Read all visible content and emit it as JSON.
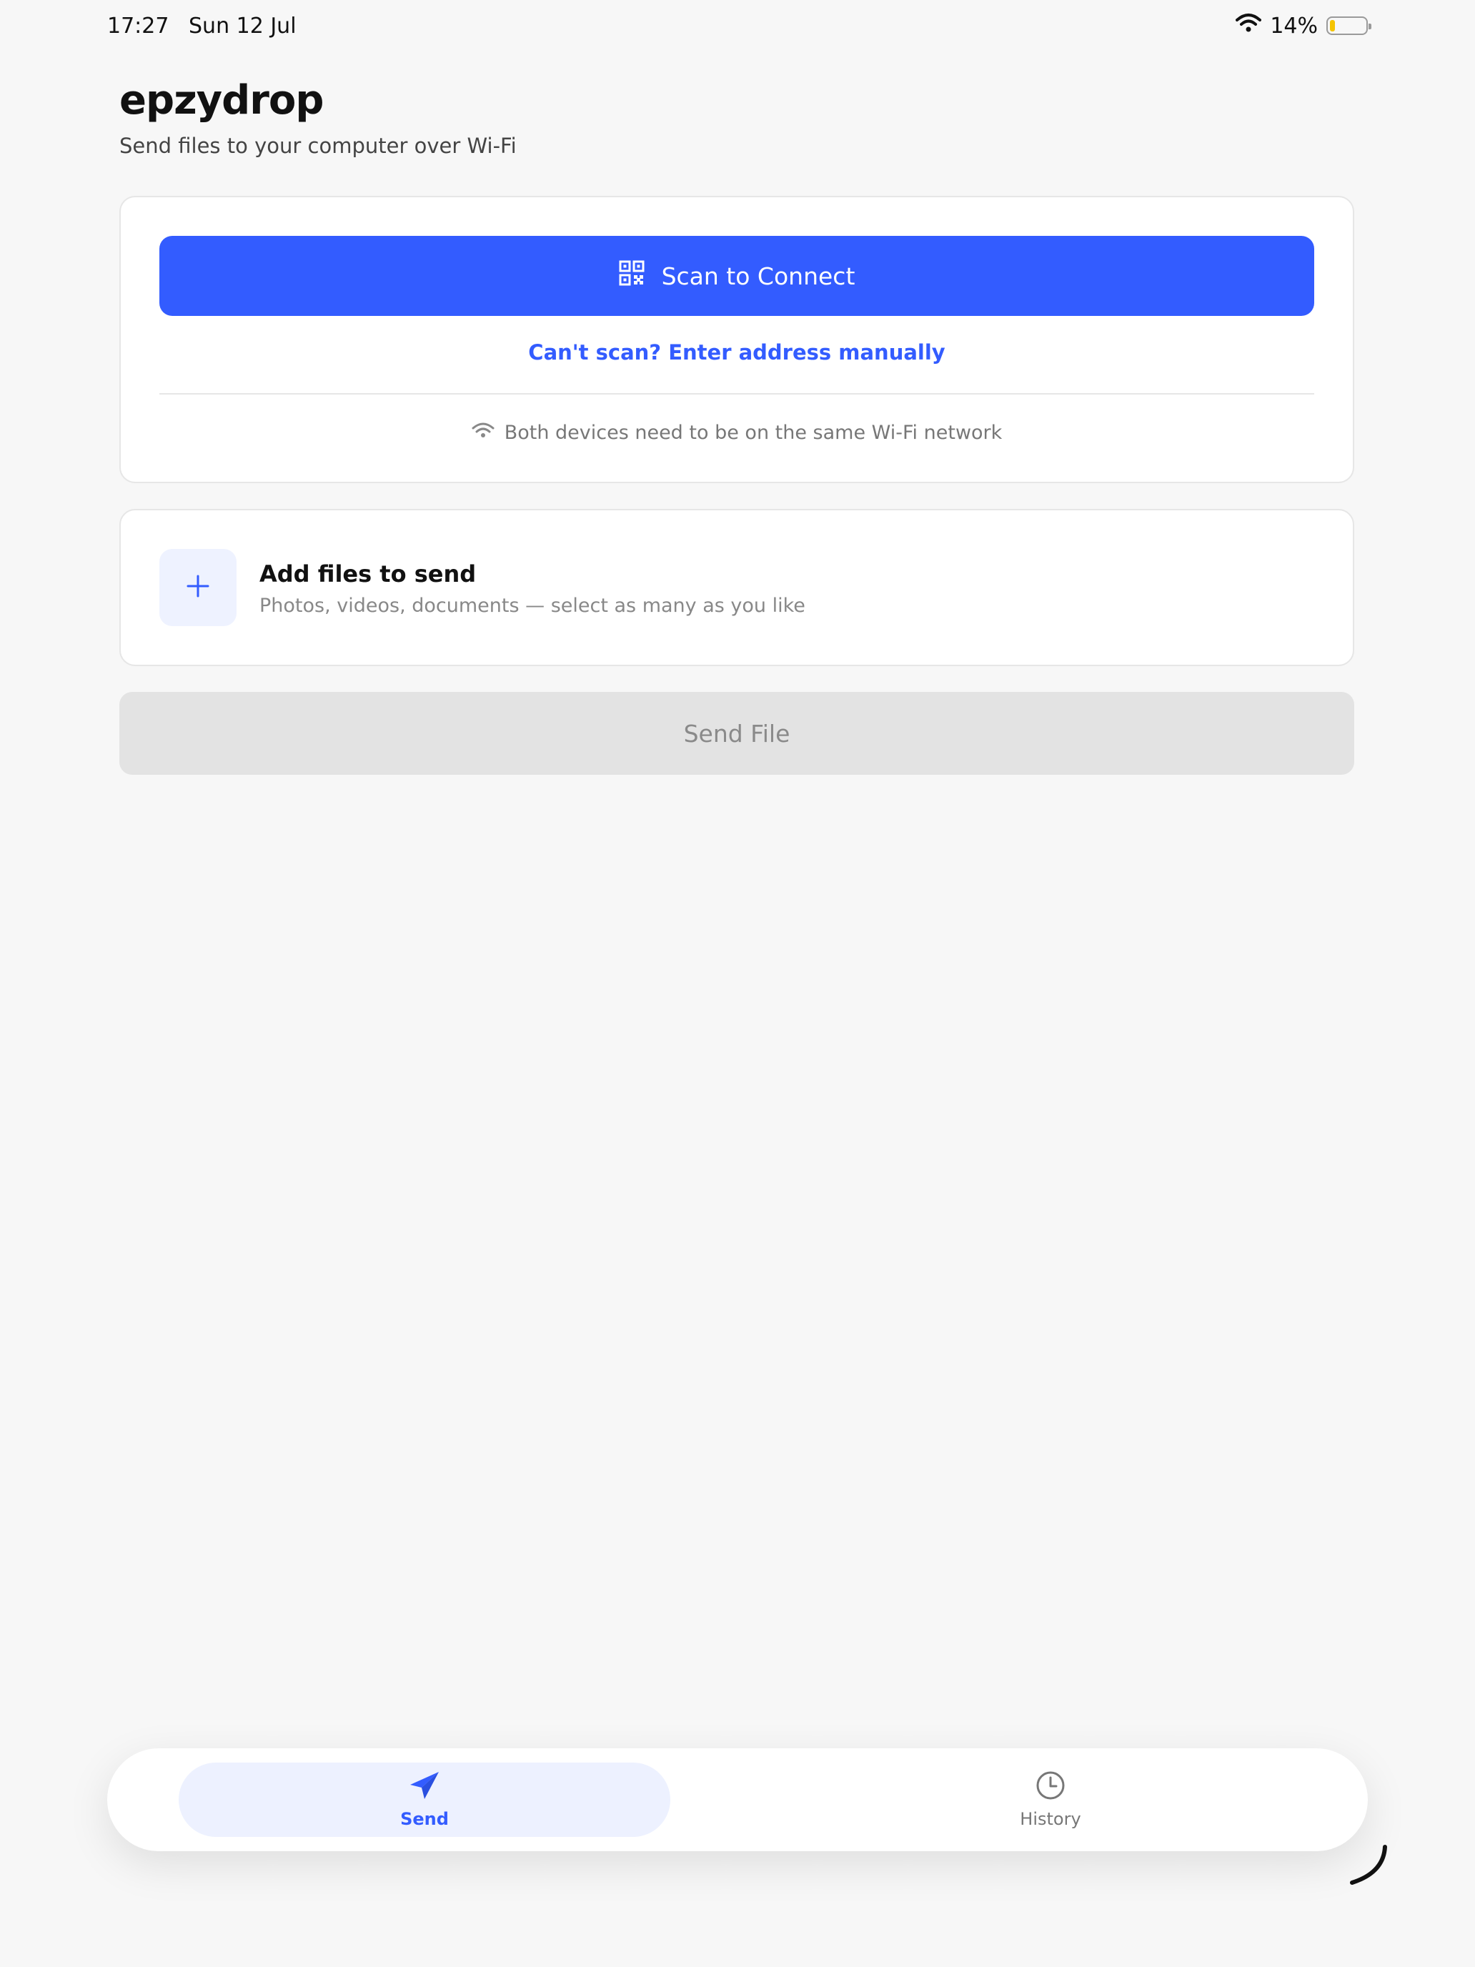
{
  "status_bar": {
    "time": "17:27",
    "date": "Sun 12 Jul",
    "battery_text": "14%",
    "battery_level_percent": 14,
    "icons": [
      "wifi-icon",
      "battery-icon"
    ]
  },
  "header": {
    "title": "epzydrop",
    "subtitle": "Send files to your computer over Wi-Fi"
  },
  "connect_card": {
    "scan_button_label": "Scan to Connect",
    "scan_icon": "qr-code-icon",
    "manual_link": "Can't scan? Enter address manually",
    "wifi_note": "Both devices need to be on the same Wi-Fi network",
    "wifi_note_icon": "wifi-icon"
  },
  "add_files_card": {
    "icon": "plus-icon",
    "title": "Add files to send",
    "description": "Photos, videos, documents — select as many as you like"
  },
  "send_file_button": "Send File",
  "tabbar": {
    "tabs": [
      {
        "label": "Send",
        "icon": "send-icon",
        "active": true
      },
      {
        "label": "History",
        "icon": "clock-icon",
        "active": false
      }
    ]
  },
  "colors": {
    "accent": "#335cff",
    "background": "#f7f7f7",
    "card": "#ffffff",
    "disabled_button": "#e3e3e3",
    "battery_fill": "#f5c400"
  }
}
